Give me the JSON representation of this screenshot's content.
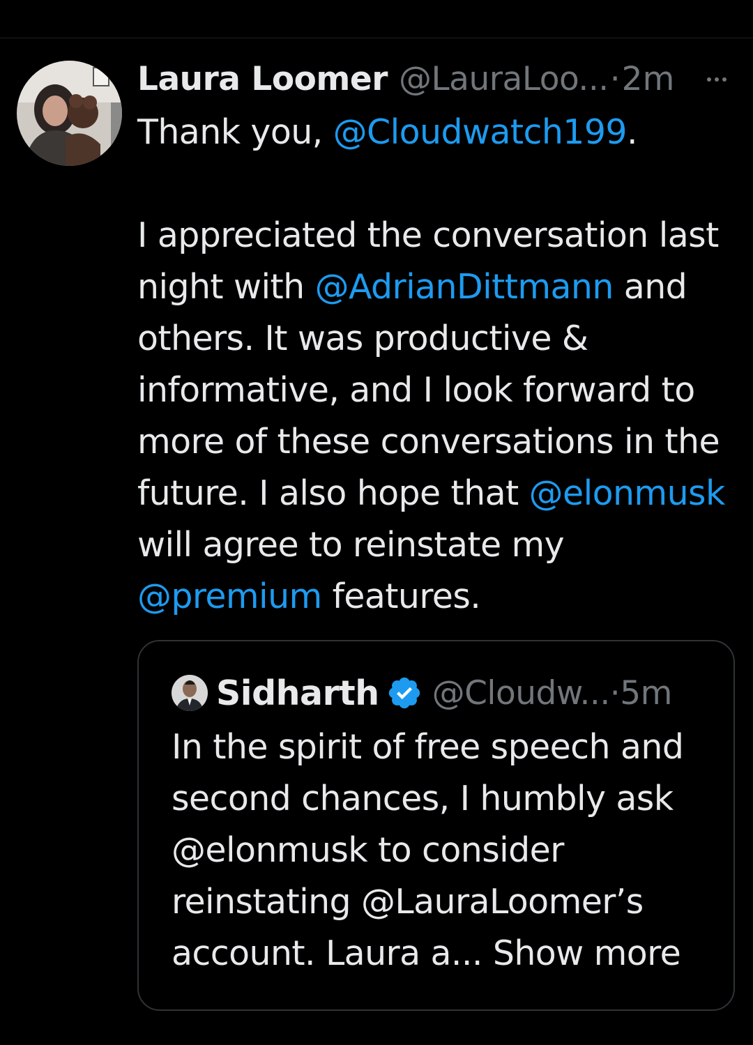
{
  "tweet": {
    "display_name": "Laura Loomer",
    "handle": "@LauraLoo...",
    "separator": "·",
    "time": "2m",
    "more_icon": "more-horizontal-icon",
    "body_lines": [
      [
        {
          "t": "Thank you, "
        },
        {
          "t": "@Cloudwatch199",
          "m": true
        },
        {
          "t": "."
        }
      ],
      [
        {
          "t": ""
        }
      ],
      [
        {
          "t": "I appreciated the conversation last"
        }
      ],
      [
        {
          "t": "night with "
        },
        {
          "t": "@AdrianDittmann",
          "m": true
        },
        {
          "t": " and"
        }
      ],
      [
        {
          "t": "others. It was productive &"
        }
      ],
      [
        {
          "t": "informative, and I look forward to"
        }
      ],
      [
        {
          "t": "more of these conversations in the"
        }
      ],
      [
        {
          "t": "future. I also hope that "
        },
        {
          "t": "@elonmusk",
          "m": true
        }
      ],
      [
        {
          "t": "will agree to reinstate my"
        }
      ],
      [
        {
          "t": "@premium",
          "m": true
        },
        {
          "t": " features."
        }
      ]
    ]
  },
  "quote": {
    "display_name": "Sidharth",
    "verified_icon": "verified-badge-icon",
    "handle": "@Cloudw...",
    "separator": "·",
    "time": "5m",
    "body_lines": [
      "In the spirit of free speech and",
      "second chances, I humbly ask",
      "@elonmusk to consider",
      "reinstating @LauraLoomer’s",
      "account. Laura a..."
    ],
    "show_more": "Show more"
  },
  "colors": {
    "background": "#000000",
    "text": "#e7e9ea",
    "muted": "#71767b",
    "mention": "#1d9bf0",
    "verified": "#1d9bf0",
    "border": "#2f3336"
  }
}
